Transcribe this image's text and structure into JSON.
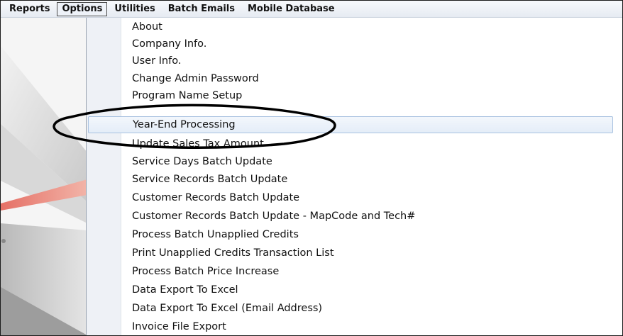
{
  "menubar": {
    "items": [
      {
        "label": "Reports",
        "active": false
      },
      {
        "label": "Options",
        "active": true
      },
      {
        "label": "Utilities",
        "active": false
      },
      {
        "label": "Batch Emails",
        "active": false
      },
      {
        "label": "Mobile Database",
        "active": false
      }
    ]
  },
  "options_menu": {
    "items": [
      {
        "label": "About"
      },
      {
        "label": "Company Info."
      },
      {
        "label": "User Info."
      },
      {
        "label": "Change Admin Password"
      },
      {
        "label": "Program Name Setup"
      },
      {
        "label": "Year-End Processing",
        "highlighted": true
      },
      {
        "label": "Update Sales Tax Amount"
      },
      {
        "label": "Service Days Batch Update"
      },
      {
        "label": "Service Records Batch Update"
      },
      {
        "label": "Customer Records Batch Update"
      },
      {
        "label": "Customer Records Batch Update - MapCode and Tech#"
      },
      {
        "label": "Process Batch Unapplied Credits"
      },
      {
        "label": "Print Unapplied Credits Transaction List"
      },
      {
        "label": "Process Batch Price Increase"
      },
      {
        "label": "Data Export To Excel"
      },
      {
        "label": "Data Export To Excel (Email Address)"
      },
      {
        "label": "Invoice File Export"
      }
    ]
  },
  "colors": {
    "highlight_border": "#a9c2e0",
    "annotation_ellipse": "#000000",
    "background_accent": "#e3837a"
  }
}
